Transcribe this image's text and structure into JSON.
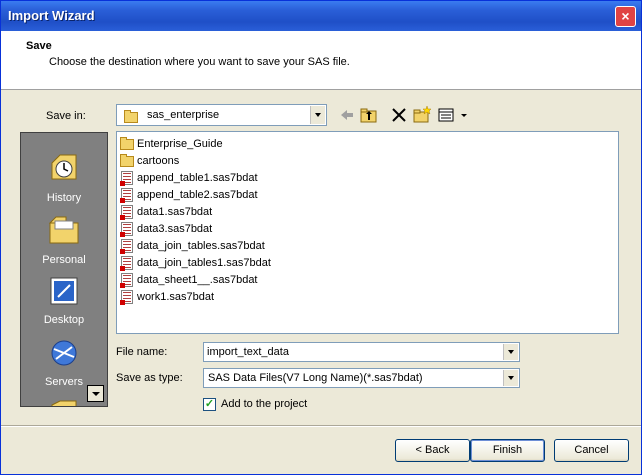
{
  "window": {
    "title": "Import Wizard",
    "close_label": "×"
  },
  "header": {
    "title": "Save",
    "description": "Choose the destination where you want to save your SAS file."
  },
  "save_in": {
    "label": "Save in:",
    "value": "sas_enterprise"
  },
  "places": [
    {
      "label": "History",
      "icon": "history-icon"
    },
    {
      "label": "Personal",
      "icon": "personal-folder-icon"
    },
    {
      "label": "Desktop",
      "icon": "desktop-icon"
    },
    {
      "label": "Servers",
      "icon": "servers-icon"
    }
  ],
  "files": [
    {
      "name": "Enterprise_Guide",
      "type": "folder"
    },
    {
      "name": "cartoons",
      "type": "folder"
    },
    {
      "name": "append_table1.sas7bdat",
      "type": "data"
    },
    {
      "name": "append_table2.sas7bdat",
      "type": "data"
    },
    {
      "name": "data1.sas7bdat",
      "type": "data"
    },
    {
      "name": "data3.sas7bdat",
      "type": "data"
    },
    {
      "name": "data_join_tables.sas7bdat",
      "type": "data"
    },
    {
      "name": "data_join_tables1.sas7bdat",
      "type": "data"
    },
    {
      "name": "data_sheet1__.sas7bdat",
      "type": "data"
    },
    {
      "name": "work1.sas7bdat",
      "type": "data"
    }
  ],
  "file_name": {
    "label": "File name:",
    "value": "import_text_data"
  },
  "save_as_type": {
    "label": "Save as type:",
    "value": "SAS Data Files(V7 Long Name)(*.sas7bdat)"
  },
  "add_to_project": {
    "label": "Add to the project",
    "checked": true
  },
  "buttons": {
    "back": "< Back",
    "finish": "Finish",
    "cancel": "Cancel"
  }
}
